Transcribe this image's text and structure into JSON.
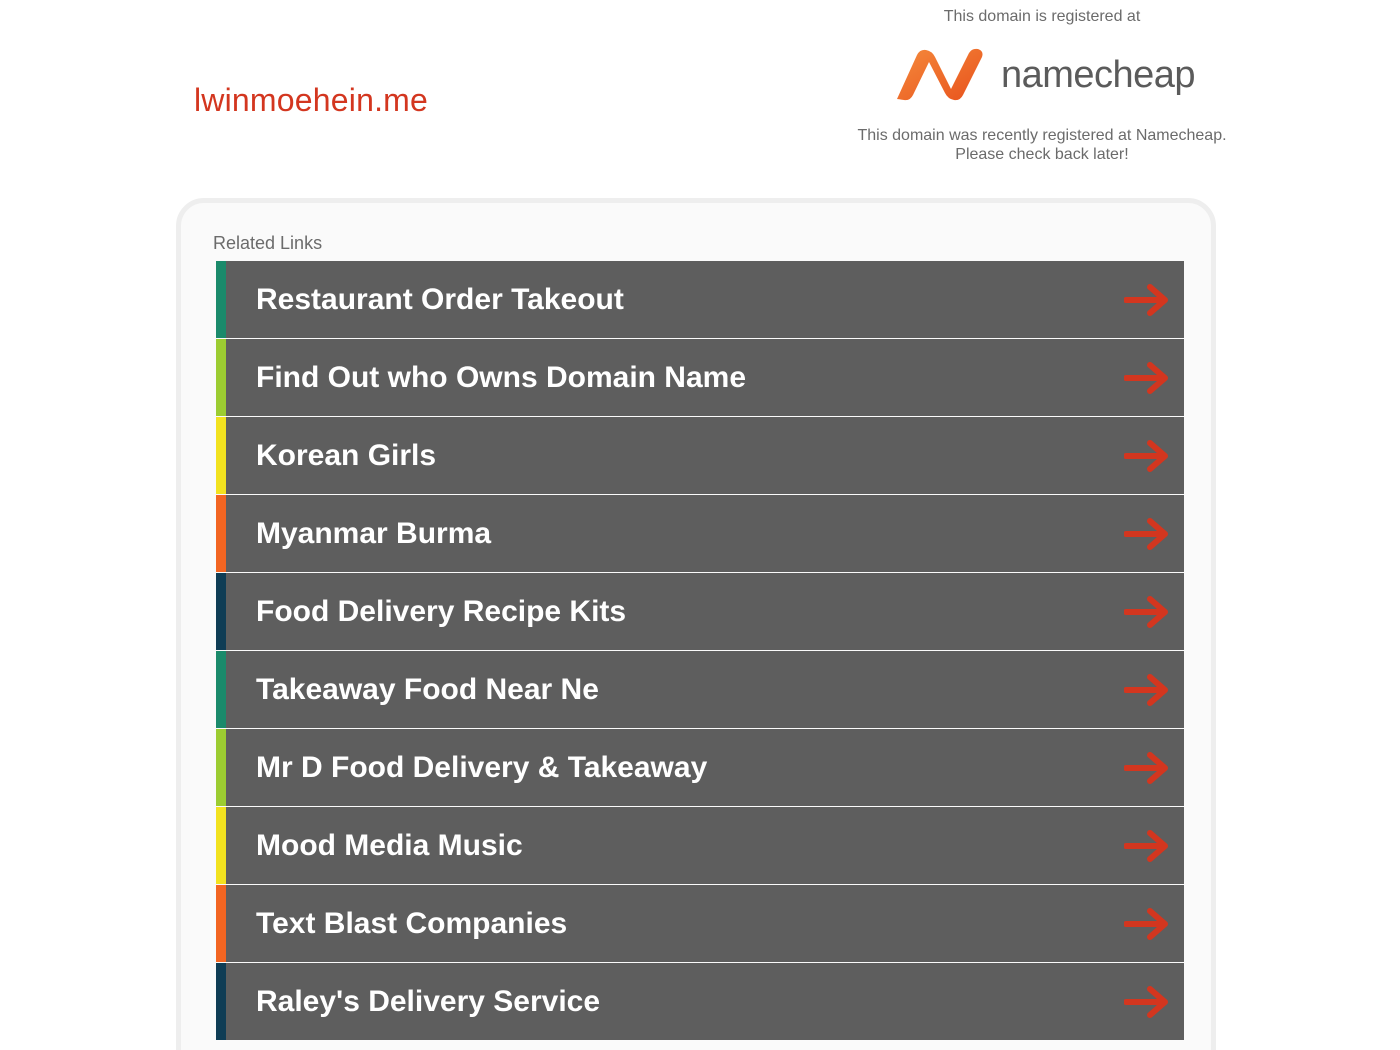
{
  "header": {
    "domain": "lwinmoehein.me"
  },
  "registrar": {
    "registered_at": "This domain is registered at",
    "logo_text": "namecheap",
    "note_line1": "This domain was recently registered at Namecheap.",
    "note_line2": "Please check back later!",
    "brand_color": "#f26522"
  },
  "related": {
    "label": "Related Links",
    "arrow_icon": "right-arrow-icon",
    "arrow_color": "#d3361f",
    "items": [
      {
        "label": "Restaurant Order Takeout",
        "stripe": "#1b8a6b"
      },
      {
        "label": "Find Out who Owns Domain Name",
        "stripe": "#9ccc31"
      },
      {
        "label": "Korean Girls",
        "stripe": "#f2e21f"
      },
      {
        "label": "Myanmar Burma",
        "stripe": "#f26522"
      },
      {
        "label": "Food Delivery Recipe Kits",
        "stripe": "#0f3d55"
      },
      {
        "label": "Takeaway Food Near Ne",
        "stripe": "#1b8a6b"
      },
      {
        "label": "Mr D Food Delivery & Takeaway",
        "stripe": "#9ccc31"
      },
      {
        "label": "Mood Media Music",
        "stripe": "#f2e21f"
      },
      {
        "label": "Text Blast Companies",
        "stripe": "#f26522"
      },
      {
        "label": "Raley's Delivery Service",
        "stripe": "#0f3d55"
      }
    ]
  }
}
